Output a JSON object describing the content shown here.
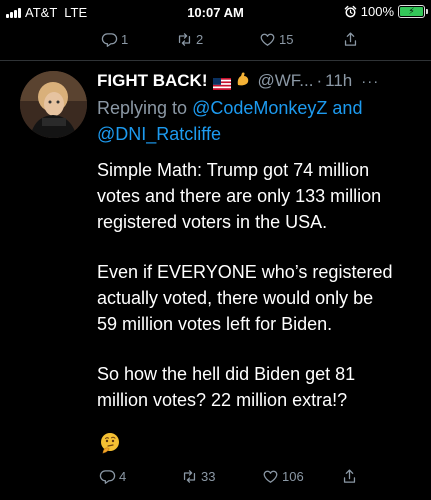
{
  "status_bar": {
    "carrier": "AT&T",
    "network": "LTE",
    "time": "10:07 AM",
    "battery": "100%",
    "alarm_icon": "alarm-clock-icon",
    "battery_color": "#34c759"
  },
  "parent_actions": {
    "reply_count": "1",
    "retweet_count": "2",
    "like_count": "15"
  },
  "tweet": {
    "author_name": "FIGHT BACK!",
    "handle": "@WF...",
    "separator": "·",
    "time_ago": "11h",
    "more": "···",
    "replying_prefix": "Replying to",
    "replying_user1": "@CodeMonkeyZ",
    "replying_and": "and",
    "replying_user2": "@DNI_Ratcliffe",
    "paragraphs": [
      [
        "Simple Math: Trump got 74 million",
        "votes and there are only 133 million",
        "registered voters in the USA."
      ],
      [
        "Even if EVERYONE who’s registered",
        "actually voted, there would only be",
        "59 million votes left for Biden."
      ],
      [
        "So how the hell did Biden get 81",
        "million votes? 22 million extra!?"
      ]
    ],
    "emoji_icon": "thinking-face-icon"
  },
  "tweet_actions": {
    "reply_count": "4",
    "retweet_count": "33",
    "like_count": "106"
  },
  "colors": {
    "background": "#000000",
    "muted": "#8b98a5",
    "link": "#1d9bf0",
    "text": "#ffffff"
  }
}
